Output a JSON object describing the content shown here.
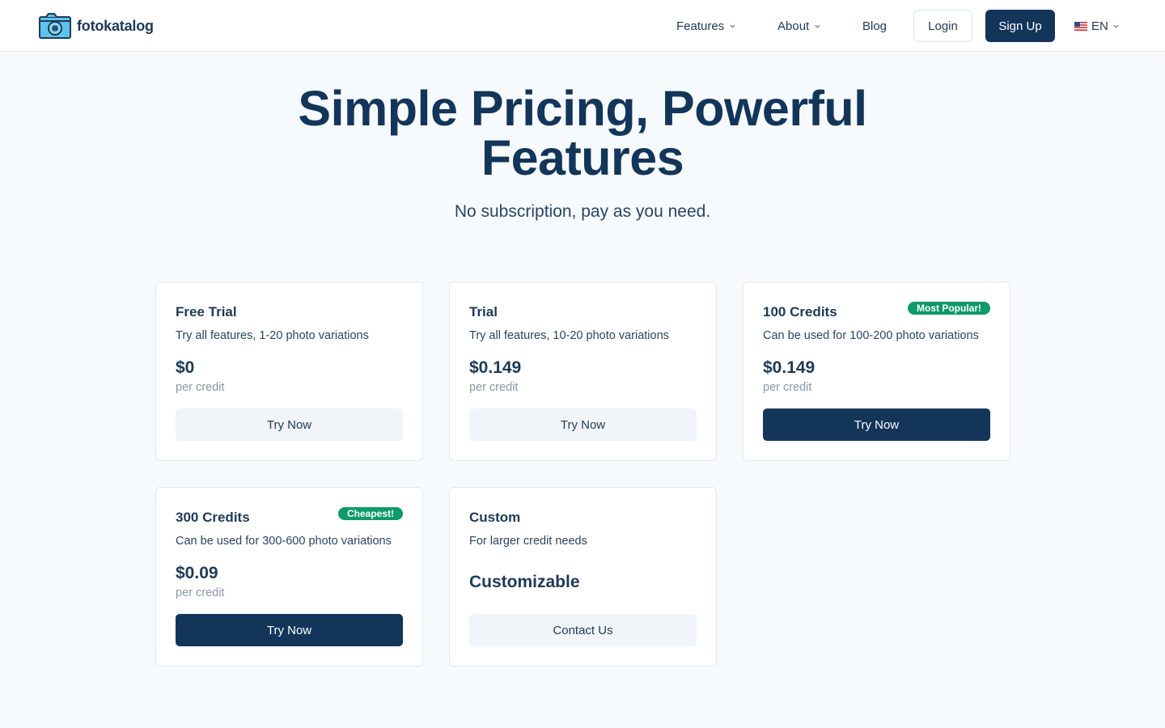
{
  "brand": {
    "name": "fotokatalog",
    "logo_icon": "camera-icon"
  },
  "nav": {
    "features": "Features",
    "about": "About",
    "blog": "Blog",
    "login": "Login",
    "signup": "Sign Up",
    "language": "EN"
  },
  "hero": {
    "title_line1": "Simple Pricing, Powerful",
    "title_line2": "Features",
    "subtitle": "No subscription, pay as you need."
  },
  "plans": [
    {
      "title": "Free Trial",
      "description": "Try all features, 1-20 photo variations",
      "price": "$0",
      "unit": "per credit",
      "button": "Try Now",
      "badge": ""
    },
    {
      "title": "Trial",
      "description": "Try all features, 10-20 photo variations",
      "price": "$0.149",
      "unit": "per credit",
      "button": "Try Now",
      "badge": ""
    },
    {
      "title": "100 Credits",
      "description": "Can be used for 100-200 photo variations",
      "price": "$0.149",
      "unit": "per credit",
      "button": "Try Now",
      "badge": "Most Popular!"
    },
    {
      "title": "300 Credits",
      "description": "Can be used for 300-600 photo variations",
      "price": "$0.09",
      "unit": "per credit",
      "button": "Try Now",
      "badge": "Cheapest!"
    },
    {
      "title": "Custom",
      "description": "For larger credit needs",
      "price": "Customizable",
      "unit": "",
      "button": "Contact Us",
      "badge": ""
    }
  ],
  "colors": {
    "primary": "#13355a",
    "badge": "#0e9a6b",
    "background": "#f6fafd"
  }
}
